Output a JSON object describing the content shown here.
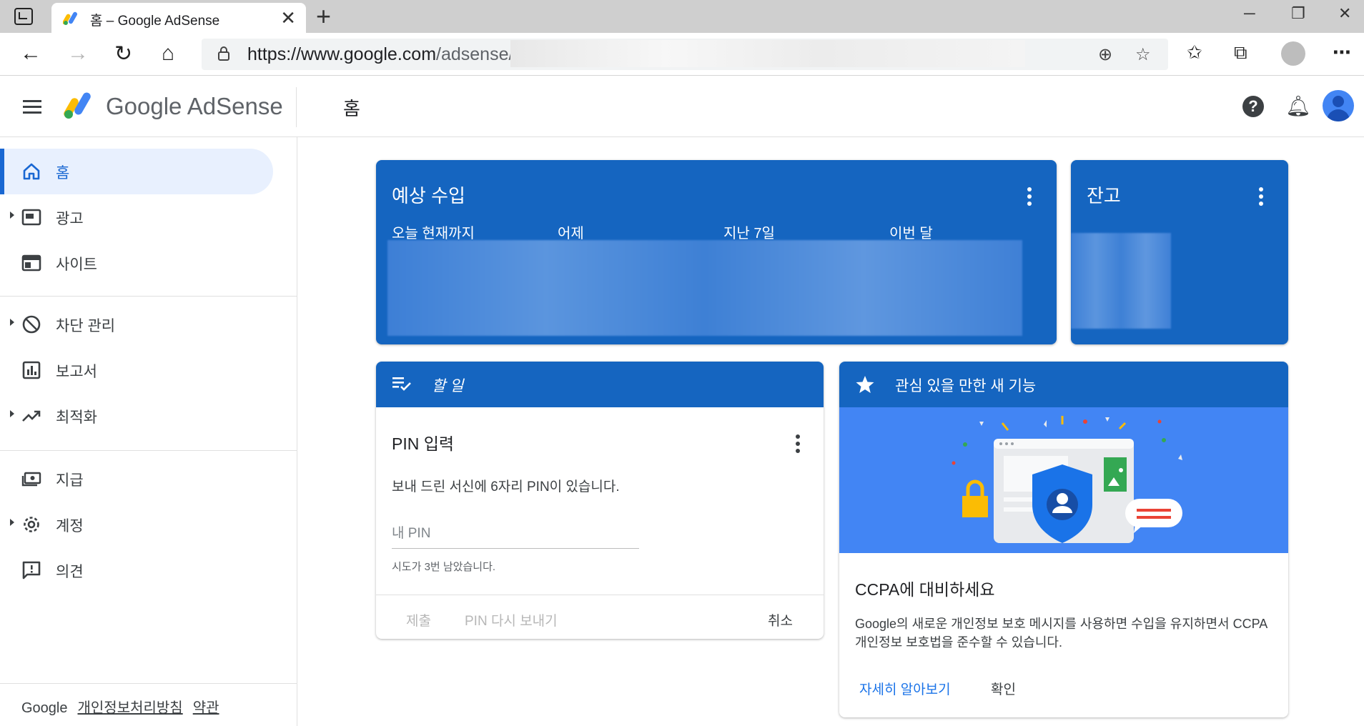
{
  "browser": {
    "tab_title": "홈 – Google AdSense",
    "url_host": "https://www.google.com",
    "url_path": "/adsense/"
  },
  "header": {
    "logo_text": "Google AdSense",
    "page_title": "홈"
  },
  "sidebar": {
    "items": [
      {
        "label": "홈",
        "icon": "home-icon"
      },
      {
        "label": "광고",
        "icon": "ads-icon"
      },
      {
        "label": "사이트",
        "icon": "sites-icon"
      },
      {
        "label": "차단 관리",
        "icon": "block-icon"
      },
      {
        "label": "보고서",
        "icon": "reports-icon"
      },
      {
        "label": "최적화",
        "icon": "trending-up-icon"
      },
      {
        "label": "지급",
        "icon": "payments-icon"
      },
      {
        "label": "계정",
        "icon": "gear-icon"
      },
      {
        "label": "의견",
        "icon": "feedback-icon"
      }
    ],
    "footer": {
      "brand": "Google",
      "privacy": "개인정보처리방침",
      "terms": "약관"
    }
  },
  "earnings_card": {
    "title": "예상 수입",
    "metrics": [
      "오늘 현재까지",
      "어제",
      "지난 7일",
      "이번 달"
    ]
  },
  "balance_card": {
    "title": "잔고"
  },
  "todo_card": {
    "header": "할 일",
    "title": "PIN 입력",
    "description": "보내 드린 서신에 6자리 PIN이 있습니다.",
    "input_placeholder": "내 PIN",
    "input_value": "",
    "helper": "시도가 3번 남았습니다.",
    "actions": {
      "submit": "제출",
      "resend": "PIN 다시 보내기",
      "cancel": "취소"
    }
  },
  "feature_card": {
    "header": "관심 있을 만한 새 기능",
    "title": "CCPA에 대비하세요",
    "description": "Google의 새로운 개인정보 보호 메시지를 사용하면 수입을 유지하면서 CCPA 개인정보 보호법을 준수할 수 있습니다.",
    "learn_more": "자세히 알아보기",
    "ok": "확인"
  },
  "colors": {
    "card_blue": "#1565c0",
    "illustration_blue": "#4285f4",
    "accent": "#1a73e8",
    "active_nav_bg": "#e8f0fe"
  }
}
